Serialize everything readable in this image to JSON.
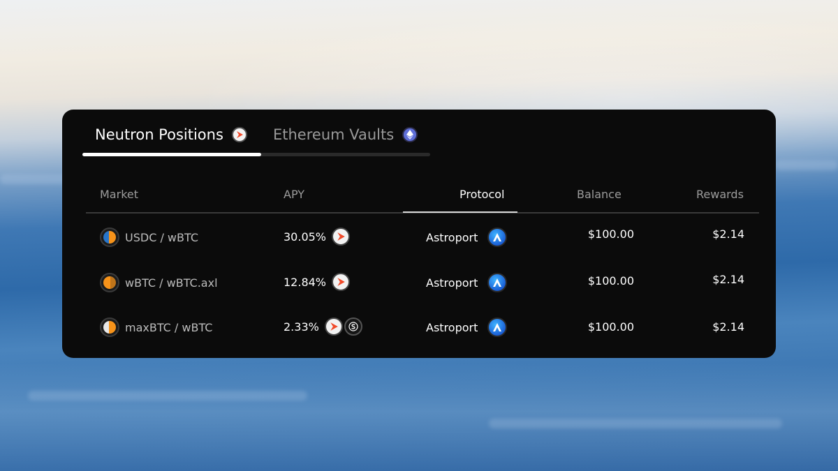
{
  "tabs": [
    {
      "label": "Neutron Positions",
      "icon": "neutron-icon",
      "active": true
    },
    {
      "label": "Ethereum Vaults",
      "icon": "ethereum-icon",
      "active": false
    }
  ],
  "table": {
    "headers": {
      "market": "Market",
      "apy": "APY",
      "protocol": "Protocol",
      "balance": "Balance",
      "rewards": "Rewards"
    },
    "sorted_column": "protocol",
    "rows": [
      {
        "market": "USDC / wBTC",
        "apy": "30.05%",
        "apy_icons": [
          "neutron-icon"
        ],
        "protocol": "Astroport",
        "balance": "$100.00",
        "rewards": "$2.14",
        "pair_colors": [
          "#2775ca",
          "#f7931a"
        ]
      },
      {
        "market": "wBTC / wBTC.axl",
        "apy": "12.84%",
        "apy_icons": [
          "neutron-icon"
        ],
        "protocol": "Astroport",
        "balance": "$100.00",
        "rewards": "$2.14",
        "pair_colors": [
          "#f7931a",
          "#f7931a"
        ]
      },
      {
        "market": "maxBTC / wBTC",
        "apy": "2.33%",
        "apy_icons": [
          "neutron-icon",
          "s-token-icon"
        ],
        "protocol": "Astroport",
        "balance": "$100.00",
        "rewards": "$2.14",
        "pair_colors": [
          "#e8e8e8",
          "#f7931a"
        ]
      }
    ]
  },
  "colors": {
    "card_bg": "#0b0b0b",
    "neutron_accent": "#f04a2a",
    "astroport_blue": "#1a5fd6",
    "ethereum_purple": "#5f6fd8"
  }
}
